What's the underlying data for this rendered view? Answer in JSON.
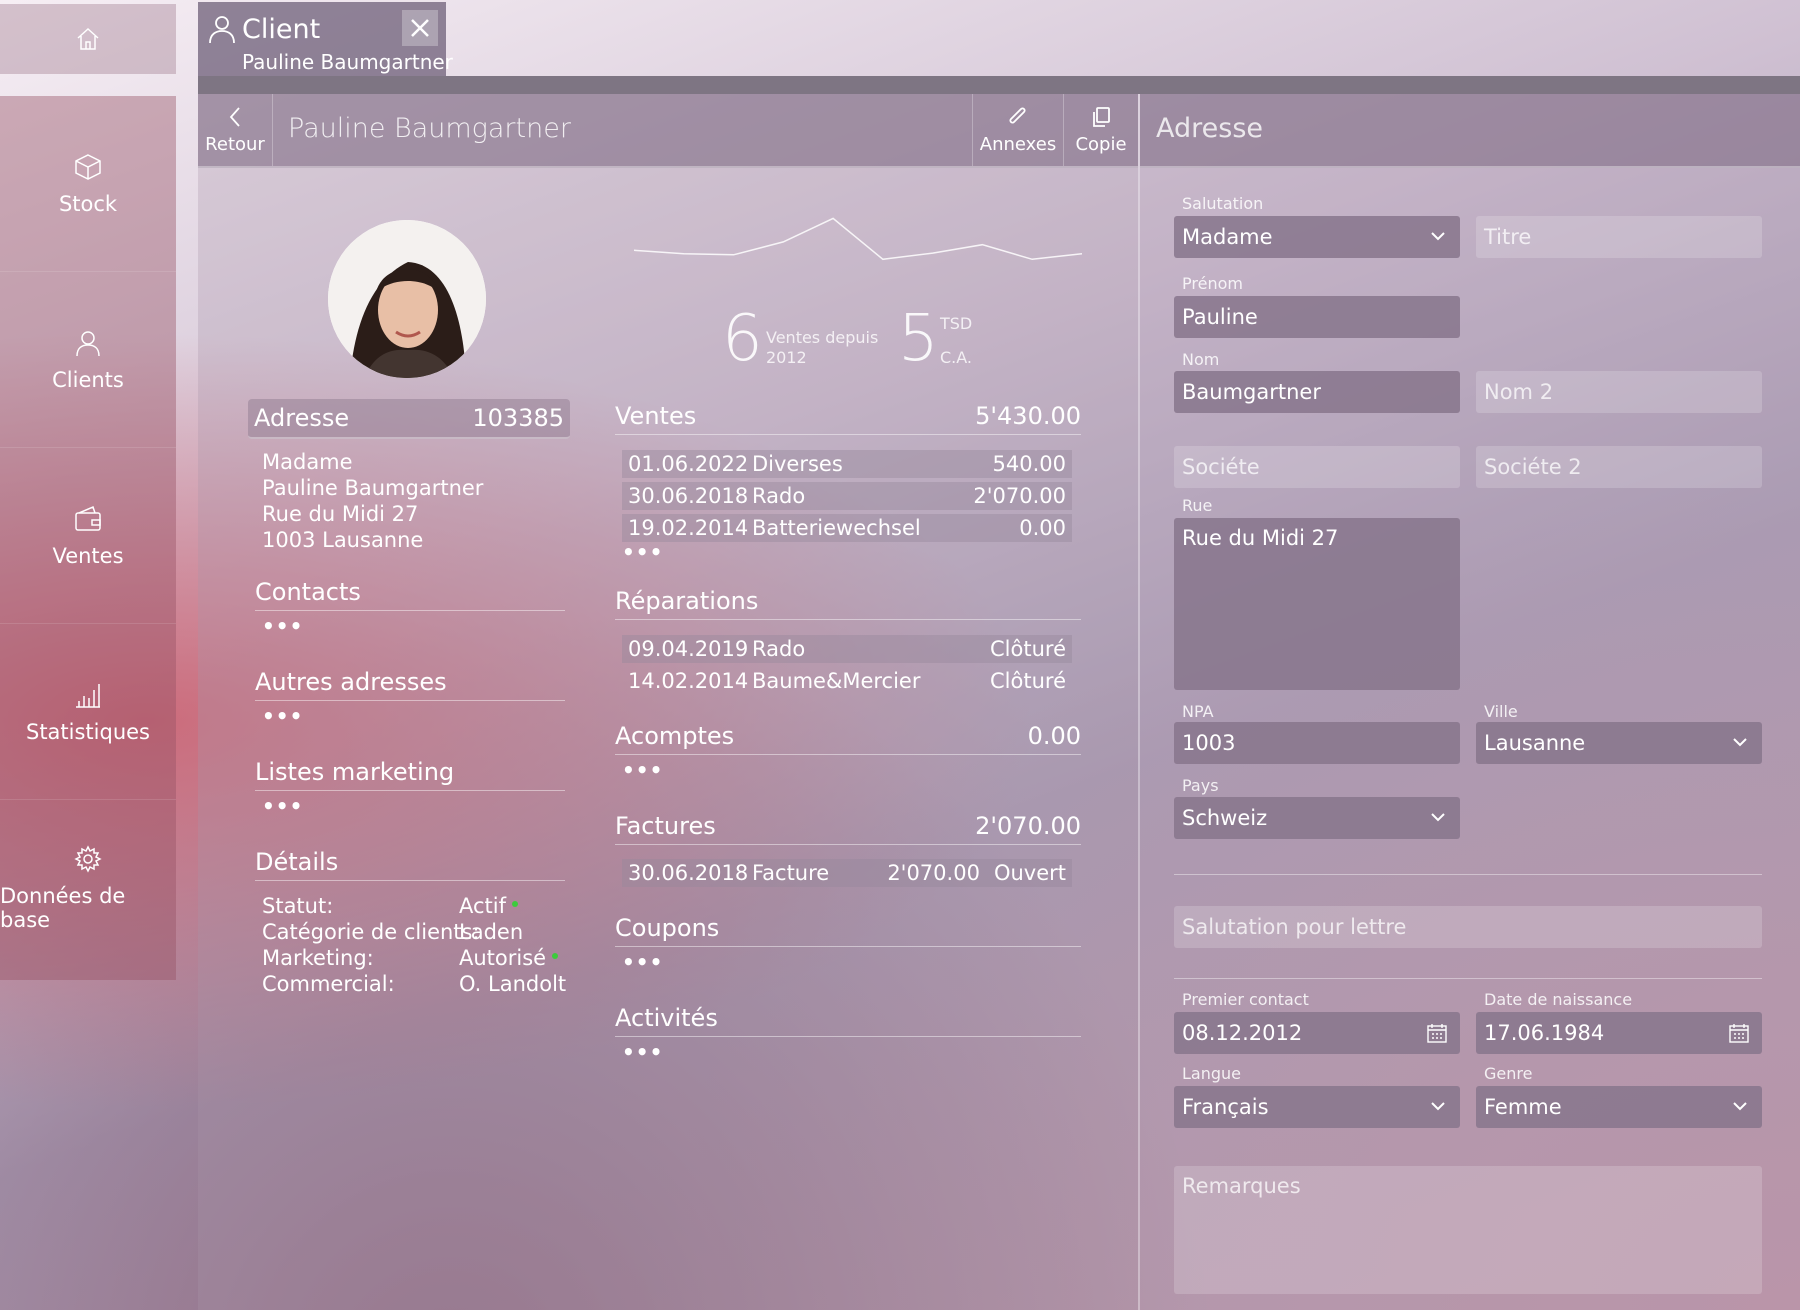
{
  "sidebar": {
    "home_icon": "home-icon",
    "items": [
      {
        "label": "Stock",
        "icon": "box-icon"
      },
      {
        "label": "Clients",
        "icon": "person-icon"
      },
      {
        "label": "Ventes",
        "icon": "wallet-icon"
      },
      {
        "label": "Statistiques",
        "icon": "bar-chart-icon"
      },
      {
        "label": "Données de base",
        "icon": "gear-icon"
      }
    ]
  },
  "tab": {
    "title": "Client",
    "subtitle": "Pauline Baumgartner"
  },
  "toolbar": {
    "back_label": "Retour",
    "title": "Pauline Baumgartner",
    "attachments_label": "Annexes",
    "copy_label": "Copie"
  },
  "address_card": {
    "title": "Adresse",
    "number": "103385",
    "lines": [
      "Madame",
      "Pauline Baumgartner",
      "Rue du Midi 27",
      "1003 Lausanne"
    ]
  },
  "left_sections": {
    "contacts": "Contacts",
    "other_addresses": "Autres adresses",
    "marketing_lists": "Listes marketing",
    "details": "Détails",
    "more": "•••"
  },
  "details": [
    {
      "key": "Statut:",
      "value": "Actif",
      "indicator": true
    },
    {
      "key": "Catégorie de clients:",
      "value": "Laden",
      "indicator": false
    },
    {
      "key": "Marketing:",
      "value": "Autorisé",
      "indicator": true
    },
    {
      "key": "Commercial:",
      "value": "O. Landolt",
      "indicator": false
    }
  ],
  "kpis": {
    "sales_count": "6",
    "sales_label_1": "Ventes depuis",
    "sales_label_2": "2012",
    "revenue": "5",
    "revenue_unit": "TSD",
    "revenue_label": "C.A."
  },
  "sparkline": [
    0.28,
    0.22,
    0.2,
    0.43,
    0.85,
    0.12,
    0.23,
    0.38,
    0.12,
    0.22
  ],
  "sales": {
    "title": "Ventes",
    "total": "5'430.00",
    "rows": [
      {
        "date": "01.06.2022",
        "desc": "Diverses",
        "amount": "540.00"
      },
      {
        "date": "30.06.2018",
        "desc": "Rado",
        "amount": "2'070.00"
      },
      {
        "date": "19.02.2014",
        "desc": "Batteriewechsel",
        "amount": "0.00"
      }
    ]
  },
  "repairs": {
    "title": "Réparations",
    "rows": [
      {
        "date": "09.04.2019",
        "desc": "Rado",
        "status": "Clôturé"
      },
      {
        "date": "14.02.2014",
        "desc": "Baume&Mercier",
        "status": "Clôturé"
      }
    ]
  },
  "deposits": {
    "title": "Acomptes",
    "total": "0.00"
  },
  "invoices": {
    "title": "Factures",
    "total": "2'070.00",
    "rows": [
      {
        "date": "30.06.2018",
        "desc": "Facture",
        "amount": "2'070.00",
        "status": "Ouvert"
      }
    ]
  },
  "coupons": {
    "title": "Coupons"
  },
  "activities": {
    "title": "Activités"
  },
  "form": {
    "header": "Adresse",
    "salutation_label": "Salutation",
    "salutation": "Madame",
    "title_placeholder": "Titre",
    "firstname_label": "Prénom",
    "firstname": "Pauline",
    "lastname_label": "Nom",
    "lastname": "Baumgartner",
    "lastname2_placeholder": "Nom 2",
    "company_placeholder": "Sociéte",
    "company2_placeholder": "Sociéte 2",
    "street_label": "Rue",
    "street": "Rue du Midi 27",
    "zip_label": "NPA",
    "zip": "1003",
    "city_label": "Ville",
    "city": "Lausanne",
    "country_label": "Pays",
    "country": "Schweiz",
    "letter_salutation_placeholder": "Salutation pour lettre",
    "first_contact_label": "Premier contact",
    "first_contact": "08.12.2012",
    "birthdate_label": "Date de naissance",
    "birthdate": "17.06.1984",
    "language_label": "Langue",
    "language": "Français",
    "gender_label": "Genre",
    "gender": "Femme",
    "remarks_placeholder": "Remarques"
  },
  "colors": {
    "accent_green": "#3ccb3c",
    "sidebar": "#b85a6e",
    "field": "#87768c"
  }
}
